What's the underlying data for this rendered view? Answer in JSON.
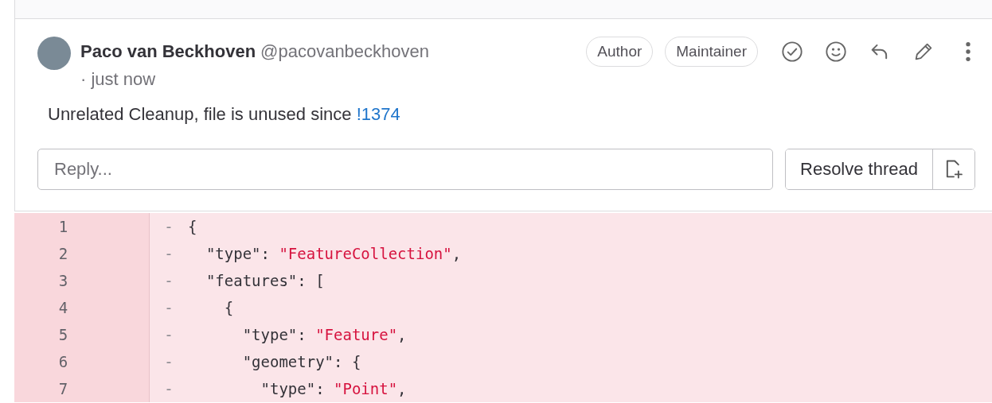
{
  "comment": {
    "author": "Paco van Beckhoven",
    "handle": "@pacovanbeckhoven",
    "time": "· just now",
    "badges": [
      "Author",
      "Maintainer"
    ],
    "body": {
      "text": "Unrelated Cleanup, file is unused since ",
      "link": "!1374"
    }
  },
  "reply": {
    "placeholder": "Reply..."
  },
  "resolve_button": "Resolve thread",
  "diff": {
    "lines": [
      {
        "number": "1",
        "marker": "-",
        "segments": [
          {
            "kind": "plain",
            "text": "{"
          }
        ]
      },
      {
        "number": "2",
        "marker": "-",
        "segments": [
          {
            "kind": "plain",
            "text": "  \"type\": "
          },
          {
            "kind": "string",
            "text": "\"FeatureCollection\""
          },
          {
            "kind": "plain",
            "text": ","
          }
        ]
      },
      {
        "number": "3",
        "marker": "-",
        "segments": [
          {
            "kind": "plain",
            "text": "  \"features\": ["
          }
        ]
      },
      {
        "number": "4",
        "marker": "-",
        "segments": [
          {
            "kind": "plain",
            "text": "    {"
          }
        ]
      },
      {
        "number": "5",
        "marker": "-",
        "segments": [
          {
            "kind": "plain",
            "text": "      \"type\": "
          },
          {
            "kind": "string",
            "text": "\"Feature\""
          },
          {
            "kind": "plain",
            "text": ","
          }
        ]
      },
      {
        "number": "6",
        "marker": "-",
        "segments": [
          {
            "kind": "plain",
            "text": "      \"geometry\": {"
          }
        ]
      },
      {
        "number": "7",
        "marker": "-",
        "segments": [
          {
            "kind": "plain",
            "text": "        \"type\": "
          },
          {
            "kind": "string",
            "text": "\"Point\""
          },
          {
            "kind": "plain",
            "text": ","
          }
        ]
      }
    ]
  }
}
